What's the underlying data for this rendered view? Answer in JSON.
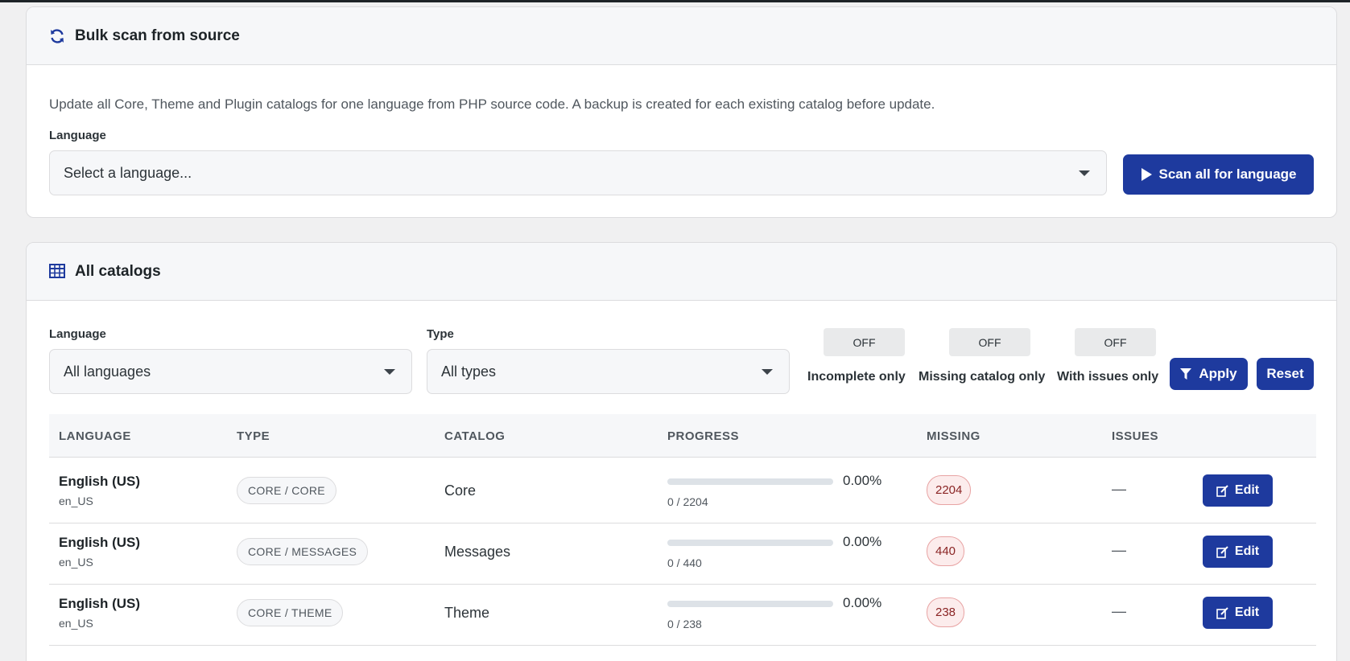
{
  "bulk_scan": {
    "title": "Bulk scan from source",
    "description": "Update all Core, Theme and Plugin catalogs for one language from PHP source code. A backup is created for each existing catalog before update.",
    "language_label": "Language",
    "language_placeholder": "Select a language...",
    "scan_button": "Scan all for language",
    "icon": "refresh-icon"
  },
  "catalogs": {
    "title": "All catalogs",
    "icon": "table-icon",
    "filters": {
      "language_label": "Language",
      "language_value": "All languages",
      "type_label": "Type",
      "type_value": "All types",
      "toggles": [
        {
          "state": "OFF",
          "label": "Incomplete only"
        },
        {
          "state": "OFF",
          "label": "Missing catalog only"
        },
        {
          "state": "OFF",
          "label": "With issues only"
        }
      ],
      "apply_button": "Apply",
      "reset_button": "Reset"
    },
    "columns": [
      "LANGUAGE",
      "TYPE",
      "CATALOG",
      "PROGRESS",
      "MISSING",
      "ISSUES"
    ],
    "rows": [
      {
        "language": "English (US)",
        "code": "en_US",
        "type": "CORE / CORE",
        "catalog": "Core",
        "percent": "0.00%",
        "progress_fraction": 0.0,
        "count": "0 / 2204",
        "missing": "2204",
        "issues": "—",
        "action": "Edit"
      },
      {
        "language": "English (US)",
        "code": "en_US",
        "type": "CORE / MESSAGES",
        "catalog": "Messages",
        "percent": "0.00%",
        "progress_fraction": 0.0,
        "count": "0 / 440",
        "missing": "440",
        "issues": "—",
        "action": "Edit"
      },
      {
        "language": "English (US)",
        "code": "en_US",
        "type": "CORE / THEME",
        "catalog": "Theme",
        "percent": "0.00%",
        "progress_fraction": 0.0,
        "count": "0 / 238",
        "missing": "238",
        "issues": "—",
        "action": "Edit"
      }
    ]
  },
  "colors": {
    "accent": "#1e3a9e",
    "missing_bg": "#fcecec",
    "missing_text": "#8a2424"
  }
}
